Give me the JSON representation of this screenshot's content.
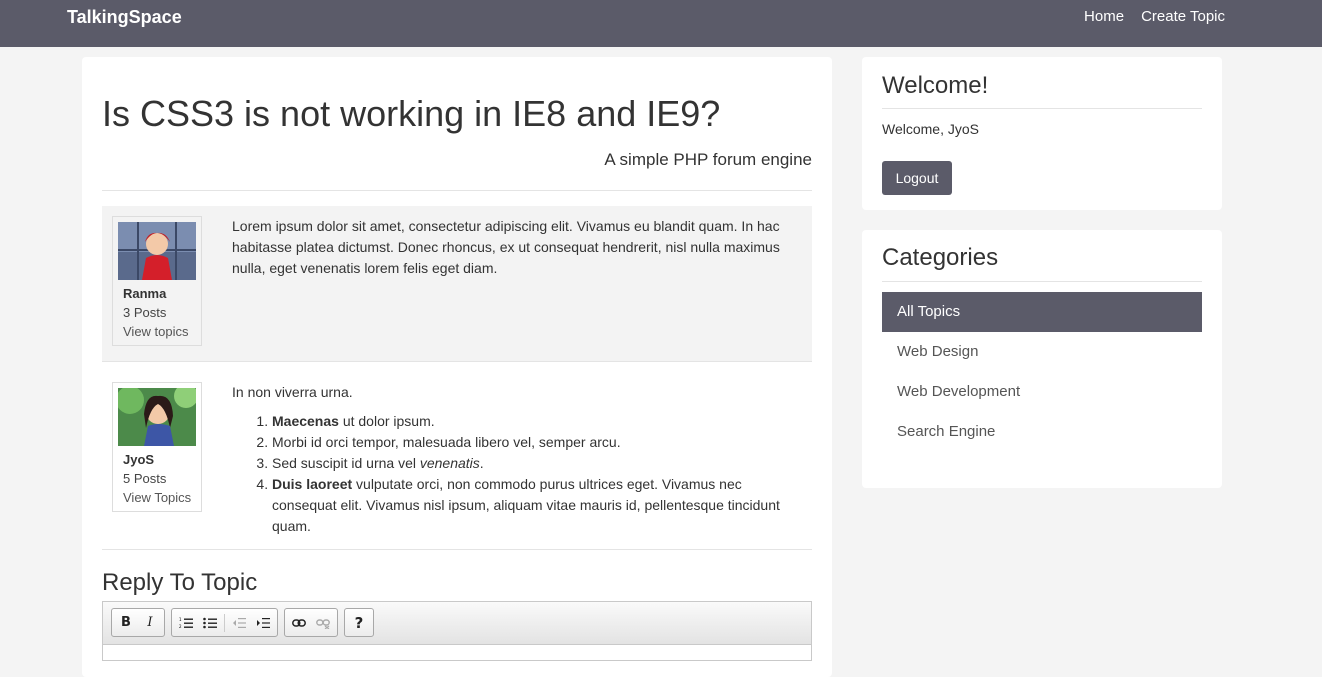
{
  "nav": {
    "brand": "TalkingSpace",
    "links": [
      "Home",
      "Create Topic"
    ]
  },
  "topic": {
    "title": "Is CSS3 is not working in IE8 and IE9?",
    "subtitle": "A simple PHP forum engine"
  },
  "posts": [
    {
      "author": "Ranma",
      "posts": "3 Posts",
      "link": "View topics",
      "body": "Lorem ipsum dolor sit amet, consectetur adipiscing elit. Vivamus eu blandit quam. In hac habitasse platea dictumst. Donec rhoncus, ex ut consequat hendrerit, nisl nulla maximus nulla, eget venenatis lorem felis eget diam."
    },
    {
      "author": "JyoS",
      "posts": "5 Posts",
      "link": "View Topics",
      "intro": "In non viverra urna.",
      "list": [
        {
          "bold": "Maecenas",
          "text": " ut dolor ipsum."
        },
        {
          "text": "Morbi id orci tempor, malesuada libero vel, semper arcu."
        },
        {
          "text": "Sed suscipit id urna vel ",
          "italic": "venenatis",
          "after": "."
        },
        {
          "bold": "Duis laoreet",
          "text": " vulputate orci, non commodo purus ultrices eget. Vivamus nec consequat elit. Vivamus nisl ipsum, aliquam vitae mauris id, pellentesque tincidunt quam."
        }
      ]
    }
  ],
  "reply": {
    "title": "Reply To Topic"
  },
  "editor_toolbar": [
    [
      "B",
      "I"
    ],
    [
      "ordered-list-icon",
      "unordered-list-icon",
      "outdent-icon",
      "indent-icon"
    ],
    [
      "link-icon",
      "unlink-icon"
    ],
    [
      "?"
    ]
  ],
  "welcome": {
    "title": "Welcome!",
    "text": "Welcome, JyoS",
    "logout": "Logout"
  },
  "categories": {
    "title": "Categories",
    "items": [
      "All Topics",
      "Web Design",
      "Web Development",
      "Search Engine"
    ],
    "active": "All Topics"
  }
}
